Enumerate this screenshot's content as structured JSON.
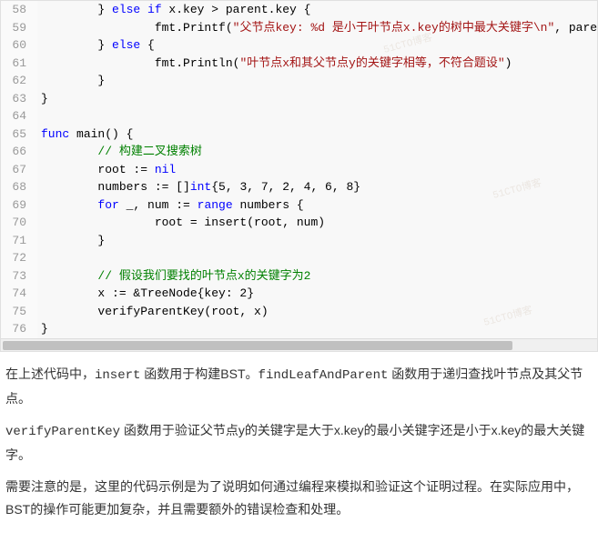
{
  "code": {
    "lines": [
      {
        "n": 58,
        "tokens": [
          {
            "t": "        } ",
            "c": ""
          },
          {
            "t": "else if",
            "c": "kw"
          },
          {
            "t": " x.key > parent.key {",
            "c": ""
          }
        ]
      },
      {
        "n": 59,
        "tokens": [
          {
            "t": "                fmt.Printf(",
            "c": ""
          },
          {
            "t": "\"父节点key: %d 是小于叶节点x.key的树中最大关键字\\n\"",
            "c": "str"
          },
          {
            "t": ", pare",
            "c": ""
          }
        ]
      },
      {
        "n": 60,
        "tokens": [
          {
            "t": "        } ",
            "c": ""
          },
          {
            "t": "else",
            "c": "kw"
          },
          {
            "t": " {",
            "c": ""
          }
        ]
      },
      {
        "n": 61,
        "tokens": [
          {
            "t": "                fmt.Println(",
            "c": ""
          },
          {
            "t": "\"叶节点x和其父节点y的关键字相等，不符合题设\"",
            "c": "str"
          },
          {
            "t": ")",
            "c": ""
          }
        ]
      },
      {
        "n": 62,
        "tokens": [
          {
            "t": "        }",
            "c": ""
          }
        ]
      },
      {
        "n": 63,
        "tokens": [
          {
            "t": "}",
            "c": ""
          }
        ]
      },
      {
        "n": 64,
        "tokens": [
          {
            "t": "",
            "c": ""
          }
        ]
      },
      {
        "n": 65,
        "tokens": [
          {
            "t": "func",
            "c": "kw"
          },
          {
            "t": " main() {",
            "c": ""
          }
        ]
      },
      {
        "n": 66,
        "tokens": [
          {
            "t": "        ",
            "c": ""
          },
          {
            "t": "// 构建二叉搜索树",
            "c": "cmt"
          }
        ]
      },
      {
        "n": 67,
        "tokens": [
          {
            "t": "        root := ",
            "c": ""
          },
          {
            "t": "nil",
            "c": "kw"
          }
        ]
      },
      {
        "n": 68,
        "tokens": [
          {
            "t": "        numbers := []",
            "c": ""
          },
          {
            "t": "int",
            "c": "kw"
          },
          {
            "t": "{5, 3, 7, 2, 4, 6, 8}",
            "c": ""
          }
        ]
      },
      {
        "n": 69,
        "tokens": [
          {
            "t": "        ",
            "c": ""
          },
          {
            "t": "for",
            "c": "kw"
          },
          {
            "t": " _, num := ",
            "c": ""
          },
          {
            "t": "range",
            "c": "kw"
          },
          {
            "t": " numbers {",
            "c": ""
          }
        ]
      },
      {
        "n": 70,
        "tokens": [
          {
            "t": "                root = insert(root, num)",
            "c": ""
          }
        ]
      },
      {
        "n": 71,
        "tokens": [
          {
            "t": "        }",
            "c": ""
          }
        ]
      },
      {
        "n": 72,
        "tokens": [
          {
            "t": "",
            "c": ""
          }
        ]
      },
      {
        "n": 73,
        "tokens": [
          {
            "t": "        ",
            "c": ""
          },
          {
            "t": "// 假设我们要找的叶节点x的关键字为2",
            "c": "cmt"
          }
        ]
      },
      {
        "n": 74,
        "tokens": [
          {
            "t": "        x := &TreeNode{key: 2}",
            "c": ""
          }
        ]
      },
      {
        "n": 75,
        "tokens": [
          {
            "t": "        verifyParentKey(root, x)",
            "c": ""
          }
        ]
      },
      {
        "n": 76,
        "tokens": [
          {
            "t": "}",
            "c": ""
          }
        ]
      }
    ]
  },
  "article": {
    "p1_a": "在上述代码中，",
    "p1_b": "insert",
    "p1_c": " 函数用于构建BST。",
    "p1_d": "findLeafAndParent",
    "p1_e": " 函数用于递归查找叶节点及其父节点。",
    "p2_a": "verifyParentKey",
    "p2_b": " 函数用于验证父节点y的关键字是大于x.key的最小关键字还是小于x.key的最大关键字。",
    "p3": "需要注意的是，这里的代码示例是为了说明如何通过编程来模拟和验证这个证明过程。在实际应用中，BST的操作可能更加复杂，并且需要额外的错误检查和处理。"
  },
  "watermarks": [
    "51CTO博客",
    "51CTO博客",
    "51CTO博客"
  ]
}
